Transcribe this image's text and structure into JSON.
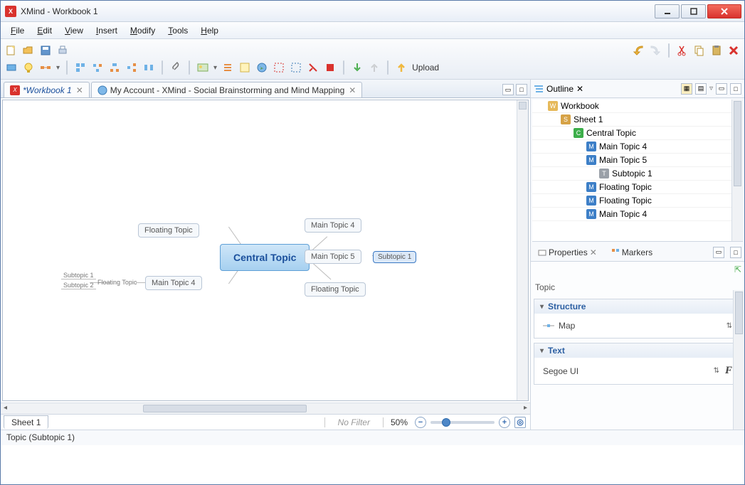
{
  "window": {
    "title": "XMind - Workbook 1"
  },
  "menu": {
    "file": "File",
    "edit": "Edit",
    "view": "View",
    "insert": "Insert",
    "modify": "Modify",
    "tools": "Tools",
    "help": "Help"
  },
  "toolbar": {
    "upload_label": "Upload"
  },
  "tabs": {
    "items": [
      {
        "label": "*Workbook 1"
      },
      {
        "label": "My Account - XMind - Social Brainstorming and Mind Mapping"
      }
    ]
  },
  "canvas": {
    "central": "Central Topic",
    "main4": "Main Topic 4",
    "main5": "Main Topic 5",
    "sub1": "Subtopic 1",
    "float1": "Floating Topic",
    "float2": "Floating Topic",
    "float3": "Floating Topic",
    "left_main4": "Main Topic 4",
    "left_sub1": "Subtopic 1",
    "left_sub2": "Subtopic 2"
  },
  "bottom": {
    "sheet": "Sheet 1",
    "nofilter": "No Filter",
    "zoom": "50%"
  },
  "outline": {
    "title": "Outline",
    "rows": [
      {
        "level": 0,
        "badge": "w",
        "label": "Workbook"
      },
      {
        "level": 1,
        "badge": "s",
        "label": "Sheet 1"
      },
      {
        "level": 2,
        "badge": "c",
        "label": "Central Topic"
      },
      {
        "level": 3,
        "badge": "m",
        "label": "Main Topic 4"
      },
      {
        "level": 3,
        "badge": "m",
        "label": "Main Topic 5"
      },
      {
        "level": 4,
        "badge": "t",
        "label": "Subtopic 1"
      },
      {
        "level": 3,
        "badge": "m",
        "label": "Floating Topic"
      },
      {
        "level": 3,
        "badge": "m",
        "label": "Floating Topic"
      },
      {
        "level": 3,
        "badge": "m",
        "label": "Main Topic 4"
      }
    ]
  },
  "properties": {
    "tab1": "Properties",
    "tab2": "Markers",
    "section_label": "Topic",
    "structure_hdr": "Structure",
    "structure_val": "Map",
    "text_hdr": "Text",
    "text_val": "Segoe UI"
  },
  "status": {
    "text": "Topic (Subtopic 1)"
  }
}
